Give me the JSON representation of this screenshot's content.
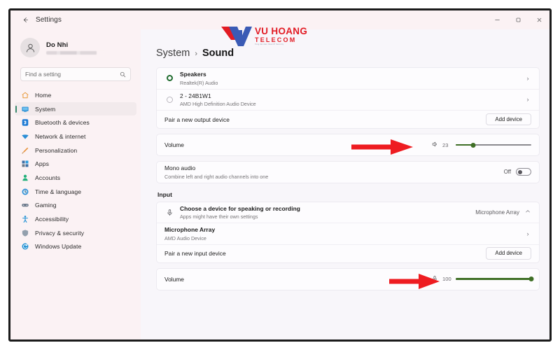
{
  "window": {
    "back_icon": "back-arrow-icon",
    "title": "Settings",
    "minimize_label": "–",
    "maximize_label": "❐",
    "close_label": "✕"
  },
  "watermark": {
    "name": "VU HOANG",
    "sub": "TELECOM",
    "tagline": "Tong dai dien thoai IP Security",
    "red": "#e21b23",
    "blue": "#3b5bb5"
  },
  "sidebar": {
    "profile": {
      "name": "Do Nhi",
      "email_redacted": true
    },
    "search": {
      "placeholder": "Find a setting",
      "value": "",
      "icon": "search-icon"
    },
    "items": [
      {
        "label": "Home",
        "icon": "home-icon",
        "active": false
      },
      {
        "label": "System",
        "icon": "system-icon",
        "active": true
      },
      {
        "label": "Bluetooth & devices",
        "icon": "bluetooth-icon",
        "active": false
      },
      {
        "label": "Network & internet",
        "icon": "wifi-icon",
        "active": false
      },
      {
        "label": "Personalization",
        "icon": "paintbrush-icon",
        "active": false
      },
      {
        "label": "Apps",
        "icon": "apps-icon",
        "active": false
      },
      {
        "label": "Accounts",
        "icon": "account-icon",
        "active": false
      },
      {
        "label": "Time & language",
        "icon": "clock-icon",
        "active": false
      },
      {
        "label": "Gaming",
        "icon": "gamepad-icon",
        "active": false
      },
      {
        "label": "Accessibility",
        "icon": "accessibility-icon",
        "active": false
      },
      {
        "label": "Privacy & security",
        "icon": "shield-icon",
        "active": false
      },
      {
        "label": "Windows Update",
        "icon": "update-icon",
        "active": false
      }
    ]
  },
  "main": {
    "breadcrumb": {
      "parent": "System",
      "separator": "›",
      "current": "Sound"
    },
    "output": {
      "devices": [
        {
          "name": "Speakers",
          "subtitle": "Realtek(R) Audio",
          "selected": true,
          "chevron": "›"
        },
        {
          "name": "2 - 24B1W1",
          "subtitle": "AMD High Definition Audio Device",
          "selected": false,
          "chevron": "›"
        }
      ],
      "pair": {
        "label": "Pair a new output device",
        "button": "Add device"
      },
      "volume": {
        "label": "Volume",
        "icon": "speaker-icon",
        "value": 23,
        "max": 100
      },
      "mono": {
        "title": "Mono audio",
        "subtitle": "Combine left and right audio channels into one",
        "state": "Off"
      }
    },
    "input": {
      "section_label": "Input",
      "chooser": {
        "icon": "microphone-icon",
        "title": "Choose a device for speaking or recording",
        "subtitle": "Apps might have their own settings",
        "value": "Microphone Array",
        "chevron": "˄"
      },
      "device": {
        "name": "Microphone Array",
        "subtitle": "AMD Audio Device",
        "chevron": "›"
      },
      "pair": {
        "label": "Pair a new input device",
        "button": "Add device"
      },
      "volume": {
        "label": "Volume",
        "icon": "microphone-icon",
        "value": 100,
        "max": 100
      }
    }
  },
  "annotations": {
    "arrow_color": "#ee1c21",
    "arrows": [
      {
        "name": "output-volume-arrow",
        "points_to": "output volume slider"
      },
      {
        "name": "input-volume-arrow",
        "points_to": "input volume slider"
      }
    ]
  }
}
